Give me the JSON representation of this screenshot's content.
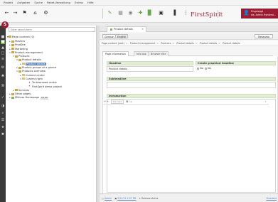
{
  "menu": [
    "Projekt",
    "Aufgaben",
    "Suche",
    "Paket-Verwaltung",
    "Extras",
    "Hilfe"
  ],
  "brand": {
    "name": "FirstSpirit",
    "user_line1": "Eingeloggt",
    "user_line2": "als: Admin Frontend…"
  },
  "tree": {
    "search_placeholder": "Enter search term",
    "root_label": "Page content (0)",
    "items": [
      {
        "label": "Masters"
      },
      {
        "label": "ProdSite"
      },
      {
        "label": "Marketing"
      },
      {
        "label": "Product management"
      },
      {
        "label": "Products"
      },
      {
        "label": "Product details"
      },
      {
        "label": "Product details"
      },
      {
        "label": "Product groups at a glance"
      },
      {
        "label": "Products overview"
      },
      {
        "label": "Content center"
      },
      {
        "label": "Content right"
      },
      {
        "label": "To download center"
      },
      {
        "label": "FirstSpirit demo project"
      },
      {
        "label": "Services"
      },
      {
        "label": "Other pages"
      },
      {
        "label": "Mithras Homepage",
        "tag": "EN DE"
      }
    ]
  },
  "editor": {
    "tab_title": "Product details",
    "langs": [
      "German",
      "English"
    ],
    "metadata_label": "Metadata",
    "breadcrumb": [
      "Page content (root)",
      "Product management",
      "Products",
      "Product details",
      "Product details",
      "Product details"
    ],
    "subtabs": [
      "Page information",
      "Info box",
      "Browser title"
    ],
    "headline_label": "Headline",
    "headline_value": "Product details",
    "create_graphical_label": "Create graphical headline",
    "radio_no_1": "No",
    "radio_no_2": "No",
    "subheadline_label": "Subheadline",
    "introduction_label": "Introduction",
    "rt_select_placeholder": "Standard",
    "rt_bold": "B",
    "rt_italic": "I"
  },
  "status": {
    "user": "Admin",
    "datetime": "5/11/11 2:57 PM",
    "note": "Release status",
    "right": "Standard"
  },
  "colors": {
    "accent": "#9b1b30",
    "green": "#6aa84f",
    "blue": "#5b80b2"
  }
}
